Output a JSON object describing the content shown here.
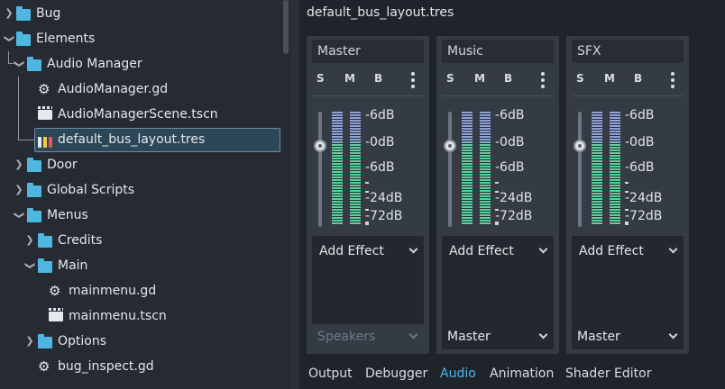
{
  "tree": {
    "items": [
      {
        "label": "Bug",
        "kind": "folder",
        "expanded": false
      },
      {
        "label": "Elements",
        "kind": "folder",
        "expanded": true
      },
      {
        "label": "Audio Manager",
        "kind": "folder",
        "expanded": true
      },
      {
        "label": "AudioManager.gd",
        "kind": "script"
      },
      {
        "label": "AudioManagerScene.tscn",
        "kind": "scene"
      },
      {
        "label": "default_bus_layout.tres",
        "kind": "bus-layout",
        "selected": true
      },
      {
        "label": "Door",
        "kind": "folder",
        "expanded": false
      },
      {
        "label": "Global Scripts",
        "kind": "folder",
        "expanded": false
      },
      {
        "label": "Menus",
        "kind": "folder",
        "expanded": true
      },
      {
        "label": "Credits",
        "kind": "folder",
        "expanded": false
      },
      {
        "label": "Main",
        "kind": "folder",
        "expanded": true
      },
      {
        "label": "mainmenu.gd",
        "kind": "script"
      },
      {
        "label": "mainmenu.tscn",
        "kind": "scene"
      },
      {
        "label": "Options",
        "kind": "folder",
        "expanded": false
      },
      {
        "label": "bug_inspect.gd",
        "kind": "script"
      }
    ]
  },
  "editor": {
    "file_title": "default_bus_layout.tres",
    "buses": [
      {
        "name": "Master",
        "solo": "S",
        "mute": "M",
        "bypass": "B",
        "add_effect": "Add Effect",
        "output": "Speakers",
        "output_disabled": true
      },
      {
        "name": "Music",
        "solo": "S",
        "mute": "M",
        "bypass": "B",
        "add_effect": "Add Effect",
        "output": "Master",
        "output_disabled": false
      },
      {
        "name": "SFX",
        "solo": "S",
        "mute": "M",
        "bypass": "B",
        "add_effect": "Add Effect",
        "output": "Master",
        "output_disabled": false
      }
    ],
    "db_scale": [
      "-6dB",
      "-0dB",
      "-6dB",
      "-24dB",
      "-72dB"
    ]
  },
  "bottom_tabs": [
    "Output",
    "Debugger",
    "Audio",
    "Animation",
    "Shader Editor"
  ],
  "active_tab": "Audio",
  "colors": {
    "accent": "#4fb4ee",
    "folder": "#4fb6e2",
    "meter_high": "#8fa3d6",
    "meter_low": "#58d3a0"
  }
}
